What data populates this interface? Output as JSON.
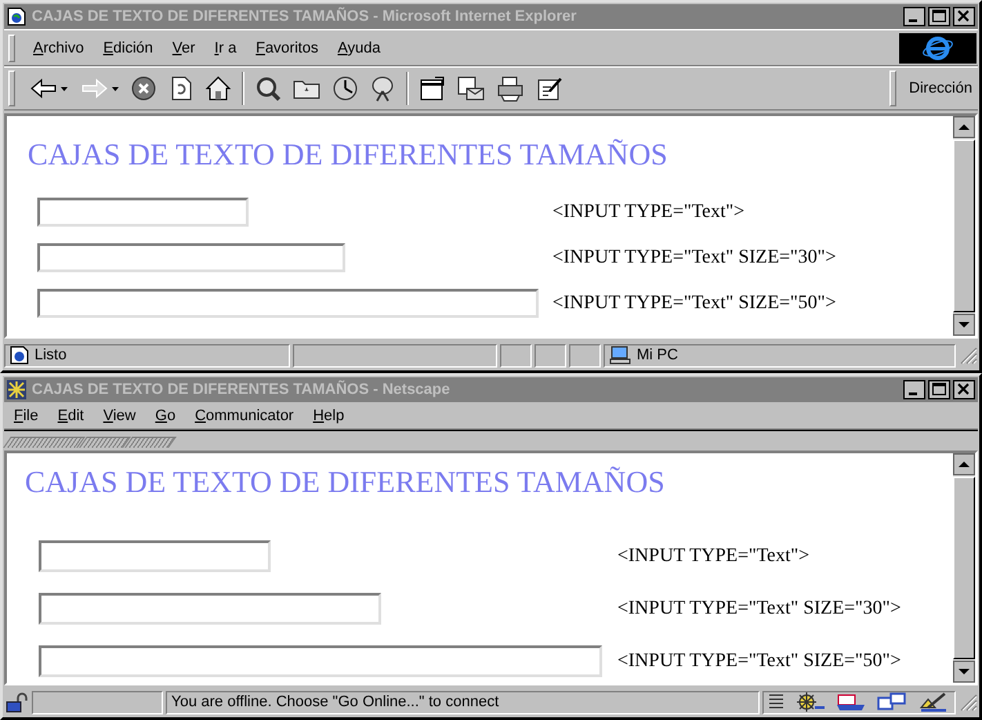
{
  "windows": [
    {
      "kind": "ie",
      "title": "CAJAS DE TEXTO DE DIFERENTES TAMAÑOS - Microsoft Internet Explorer",
      "menu": [
        "Archivo",
        "Edición",
        "Ver",
        "Ir a",
        "Favoritos",
        "Ayuda"
      ],
      "address_label": "Dirección",
      "heading": "CAJAS DE TEXTO DE DIFERENTES TAMAÑOS",
      "rows": [
        {
          "code": "<INPUT TYPE=\"Text\">"
        },
        {
          "code": "<INPUT TYPE=\"Text\" SIZE=\"30\">"
        },
        {
          "code": "<INPUT TYPE=\"Text\" SIZE=\"50\">"
        }
      ],
      "status": [
        "Listo",
        "Mi PC"
      ]
    },
    {
      "kind": "netscape",
      "title": "CAJAS DE TEXTO DE DIFERENTES TAMAÑOS - Netscape",
      "menu": [
        "File",
        "Edit",
        "View",
        "Go",
        "Communicator",
        "Help"
      ],
      "heading": "CAJAS DE TEXTO DE DIFERENTES TAMAÑOS",
      "rows": [
        {
          "code": "<INPUT TYPE=\"Text\">"
        },
        {
          "code": "<INPUT TYPE=\"Text\" SIZE=\"30\">"
        },
        {
          "code": "<INPUT TYPE=\"Text\" SIZE=\"50\">"
        }
      ],
      "status": [
        "You are offline. Choose \"Go Online...\" to connect"
      ]
    }
  ]
}
